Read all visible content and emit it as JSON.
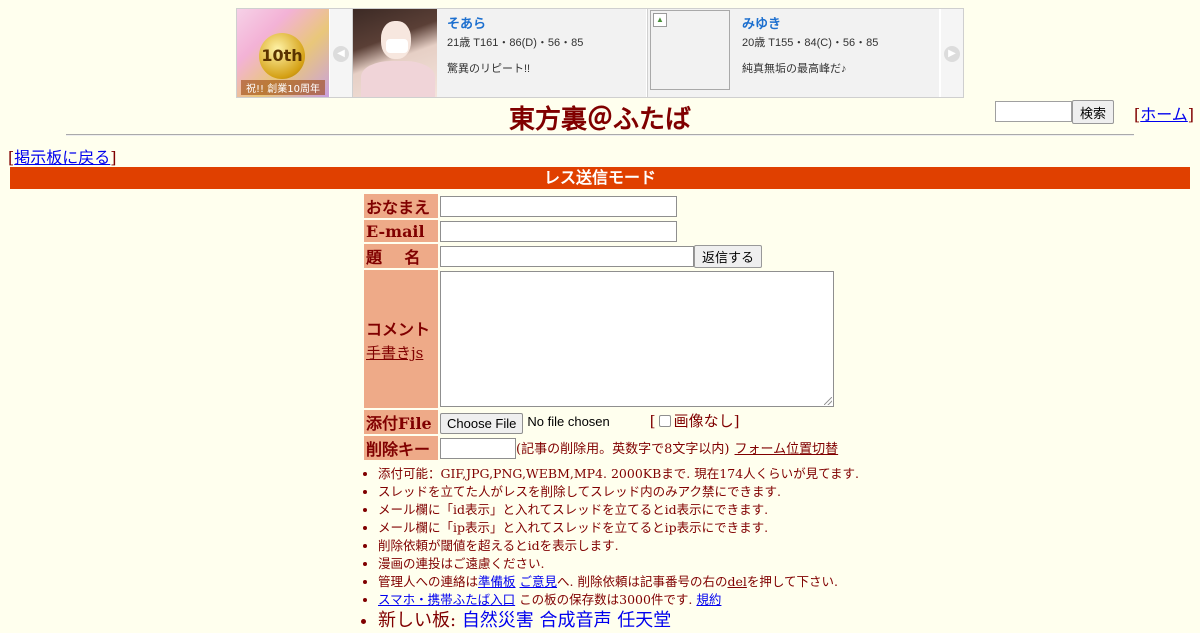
{
  "banner": {
    "logo_badge": "10th",
    "logo_caption": "祝!! 創業10周年",
    "cards": [
      {
        "name": "そあら",
        "stats": "21歳 T161・86(D)・56・85",
        "message": "驚異のリピート!!"
      },
      {
        "name": "みゆき",
        "stats": "20歳 T155・84(C)・56・85",
        "message": "純真無垢の最高峰だ♪"
      }
    ],
    "prev_glyph": "◀",
    "next_glyph": "▶"
  },
  "header": {
    "title": "東方裏＠ふたば",
    "search_button": "検索",
    "home_link": "ホーム",
    "bracket_open": "[",
    "bracket_close": "]"
  },
  "back_link": "掲示板に戻る",
  "mode_title": "レス送信モード",
  "form": {
    "name_label": "おなまえ",
    "email_label": "E-mail",
    "subject_label": "題　名",
    "submit_label": "返信する",
    "comment_label": "コメント",
    "handwrite_link": "手書きjs",
    "file_label": "添付File",
    "file_button": "Choose File",
    "file_status": "No file chosen",
    "no_image_label": "画像なし",
    "delkey_label": "削除キー",
    "delkey_note": "(記事の削除用。英数字で8文字以内)",
    "form_toggle_link": "フォーム位置切替"
  },
  "rules": {
    "r1": "添付可能：GIF,JPG,PNG,WEBM,MP4. 2000KBまで. 現在174人くらいが見てます.",
    "r2": "スレッドを立てた人がレスを削除してスレッド内のみアク禁にできます.",
    "r3": "メール欄に「id表示」と入れてスレッドを立てるとid表示にできます.",
    "r4": "メール欄に「ip表示」と入れてスレッドを立てるとip表示にできます.",
    "r5": "削除依頼が閾値を超えるとidを表示します.",
    "r6": "漫画の連投はご遠慮ください.",
    "r7_prefix": "管理人への連絡は",
    "r7_link1": "準備板",
    "r7_link2": "ご意見",
    "r7_mid": "へ. 削除依頼は記事番号の右の",
    "r7_del": "del",
    "r7_suffix": "を押して下さい.",
    "r8_link": "スマホ・携帯ふたば入口",
    "r8_text": "この板の保存数は3000件です.",
    "r8_rules_link": "規約",
    "r9_label": "新しい板:",
    "r9_links": [
      "自然災害",
      "合成音声",
      "任天堂"
    ]
  }
}
